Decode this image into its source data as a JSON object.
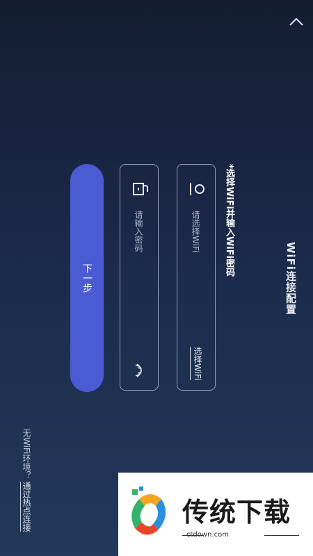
{
  "page": {
    "title": "WiFi连接配置",
    "hint": "*选择WiFi并输入WiFi密码"
  },
  "wifi": {
    "placeholder": "请选择WiFi",
    "choose_label": "选择WiFi",
    "icon": "wifi-user-icon"
  },
  "password": {
    "placeholder": "请输入密码",
    "icon": "lock-icon",
    "toggle_icon": "eye-closed-icon"
  },
  "actions": {
    "next_label": "下一步",
    "no_wifi_prefix": "无WiFi环境？",
    "no_wifi_link": "通过热点连接"
  },
  "watermark": {
    "brand": "传统下载",
    "url": "ctdown.com"
  },
  "colors": {
    "accent": "#4a5bd4",
    "background_top": "#141d33",
    "background_bottom": "#22395a"
  }
}
